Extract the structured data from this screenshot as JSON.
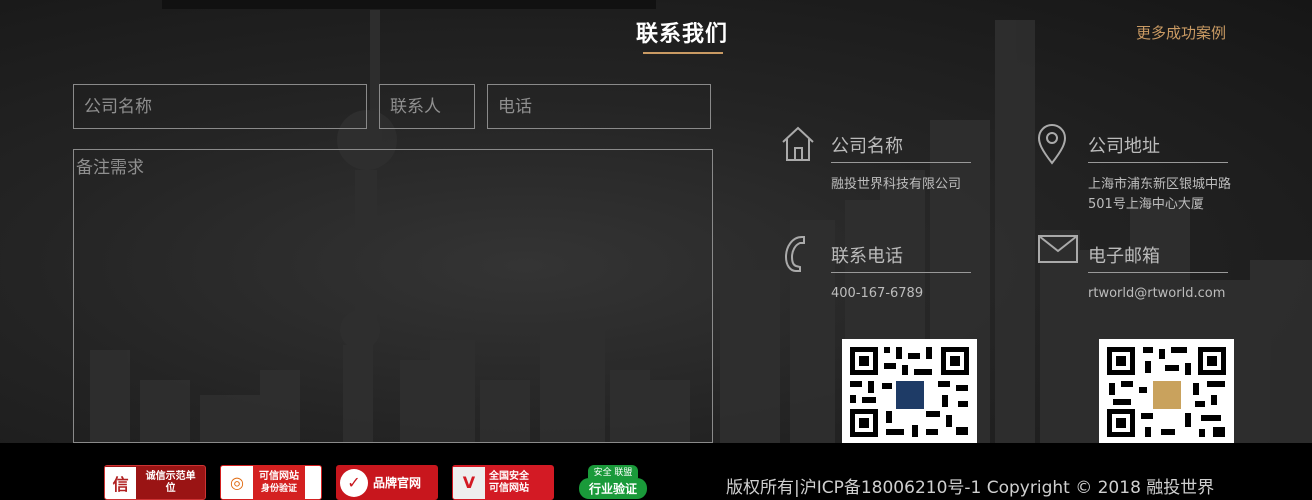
{
  "contact": {
    "title": "联系我们",
    "more_link": "更多成功案例"
  },
  "form": {
    "company_placeholder": "公司名称",
    "contact_placeholder": "联系人",
    "phone_placeholder": "电话",
    "notes_placeholder": "备注需求"
  },
  "info": {
    "company": {
      "label": "公司名称",
      "value": "融投世界科技有限公司",
      "icon": "house-icon"
    },
    "address": {
      "label": "公司地址",
      "line1": "上海市浦东新区银城中路",
      "line2": "501号上海中心大厦",
      "icon": "location-pin-icon"
    },
    "phone": {
      "label": "联系电话",
      "value": "400-167-6789",
      "icon": "phone-icon"
    },
    "email": {
      "label": "电子邮箱",
      "value": "rtworld@rtworld.com",
      "icon": "mail-icon"
    }
  },
  "footer": {
    "badges": [
      {
        "mark": "信",
        "text": "诚信示范单位",
        "color": "#b01f1f"
      },
      {
        "mark": "◎",
        "text1": "可信网站",
        "text2": "身份验证",
        "color": "#d42020"
      },
      {
        "mark": "✓",
        "text": "品牌官网",
        "color": "#c8161d"
      },
      {
        "mark": "V",
        "text1": "全国安全",
        "text2": "可信网站",
        "color": "#d31a24"
      },
      {
        "text1": "安全 联盟",
        "text2": "行业验证",
        "color": "#1a9a3a"
      }
    ],
    "copyright": "版权所有|沪ICP备18006210号-1 Copyright © 2018 融投世界"
  },
  "colors": {
    "accent": "#c99a63",
    "background": "#1b1b1b",
    "footer": "#000000"
  }
}
